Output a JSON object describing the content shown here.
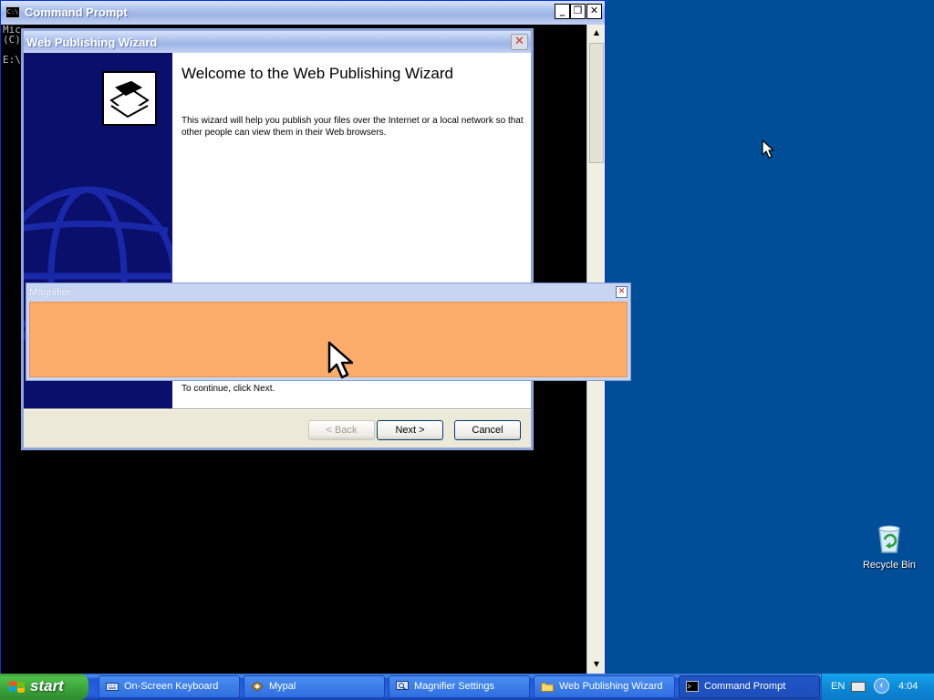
{
  "cmd": {
    "title": "Command Prompt",
    "icon": "cmd-icon",
    "icon_text": "C:\\",
    "lines": [
      "Mic",
      "(C)",
      "",
      "E:\\"
    ],
    "buttons": {
      "minimize": "_",
      "restore": "❐",
      "close": "✕"
    }
  },
  "wizard": {
    "title": "Web Publishing Wizard",
    "heading": "Welcome to the Web Publishing Wizard",
    "intro": "This wizard will help you publish your files over the Internet or a local network so that other people can view them in their Web browsers.",
    "continue_text": "To continue, click Next.",
    "back_label": "< Back",
    "next_label": "Next >",
    "cancel_label": "Cancel",
    "close": "✕"
  },
  "magnifier": {
    "title": "Magnifier",
    "close": "✕",
    "view_color": "#fcac6a"
  },
  "desktop": {
    "recycle_bin_label": "Recycle Bin",
    "background_color": "#004e98"
  },
  "taskbar": {
    "start_label": "start",
    "items": [
      {
        "label": "On-Screen Keyboard",
        "icon": "keyboard-icon"
      },
      {
        "label": "Mypal",
        "icon": "mypal-icon"
      },
      {
        "label": "Magnifier Settings",
        "icon": "magnifier-icon"
      },
      {
        "label": "Web Publishing Wizard",
        "icon": "folder-icon"
      },
      {
        "label": "Command Prompt",
        "icon": "cmd-icon"
      }
    ],
    "tray": {
      "language": "EN",
      "clock": "4:04",
      "show_hidden": "‹"
    }
  }
}
